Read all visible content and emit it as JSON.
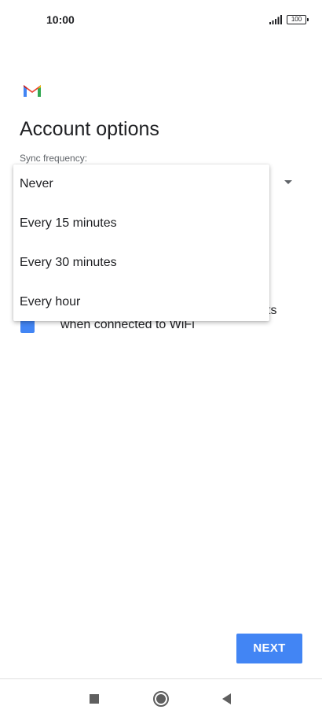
{
  "status_bar": {
    "time": "10:00",
    "battery": "100"
  },
  "page": {
    "title": "Account options",
    "sync_label": "Sync frequency:"
  },
  "dropdown": {
    "options": [
      "Never",
      "Every 15 minutes",
      "Every 30 minutes",
      "Every hour"
    ]
  },
  "checkbox": {
    "label_tail": "ts",
    "label_line2": "when connected to WiFi"
  },
  "actions": {
    "next_label": "NEXT"
  },
  "colors": {
    "accent": "#4285f4",
    "text": "#202124",
    "secondary_text": "#5f6368"
  },
  "icons": {
    "logo": "gmail-logo",
    "signal": "signal-icon",
    "battery": "battery-icon",
    "dropdown": "dropdown-arrow-icon",
    "nav_recents": "square-icon",
    "nav_home": "circle-icon",
    "nav_back": "back-triangle-icon"
  }
}
